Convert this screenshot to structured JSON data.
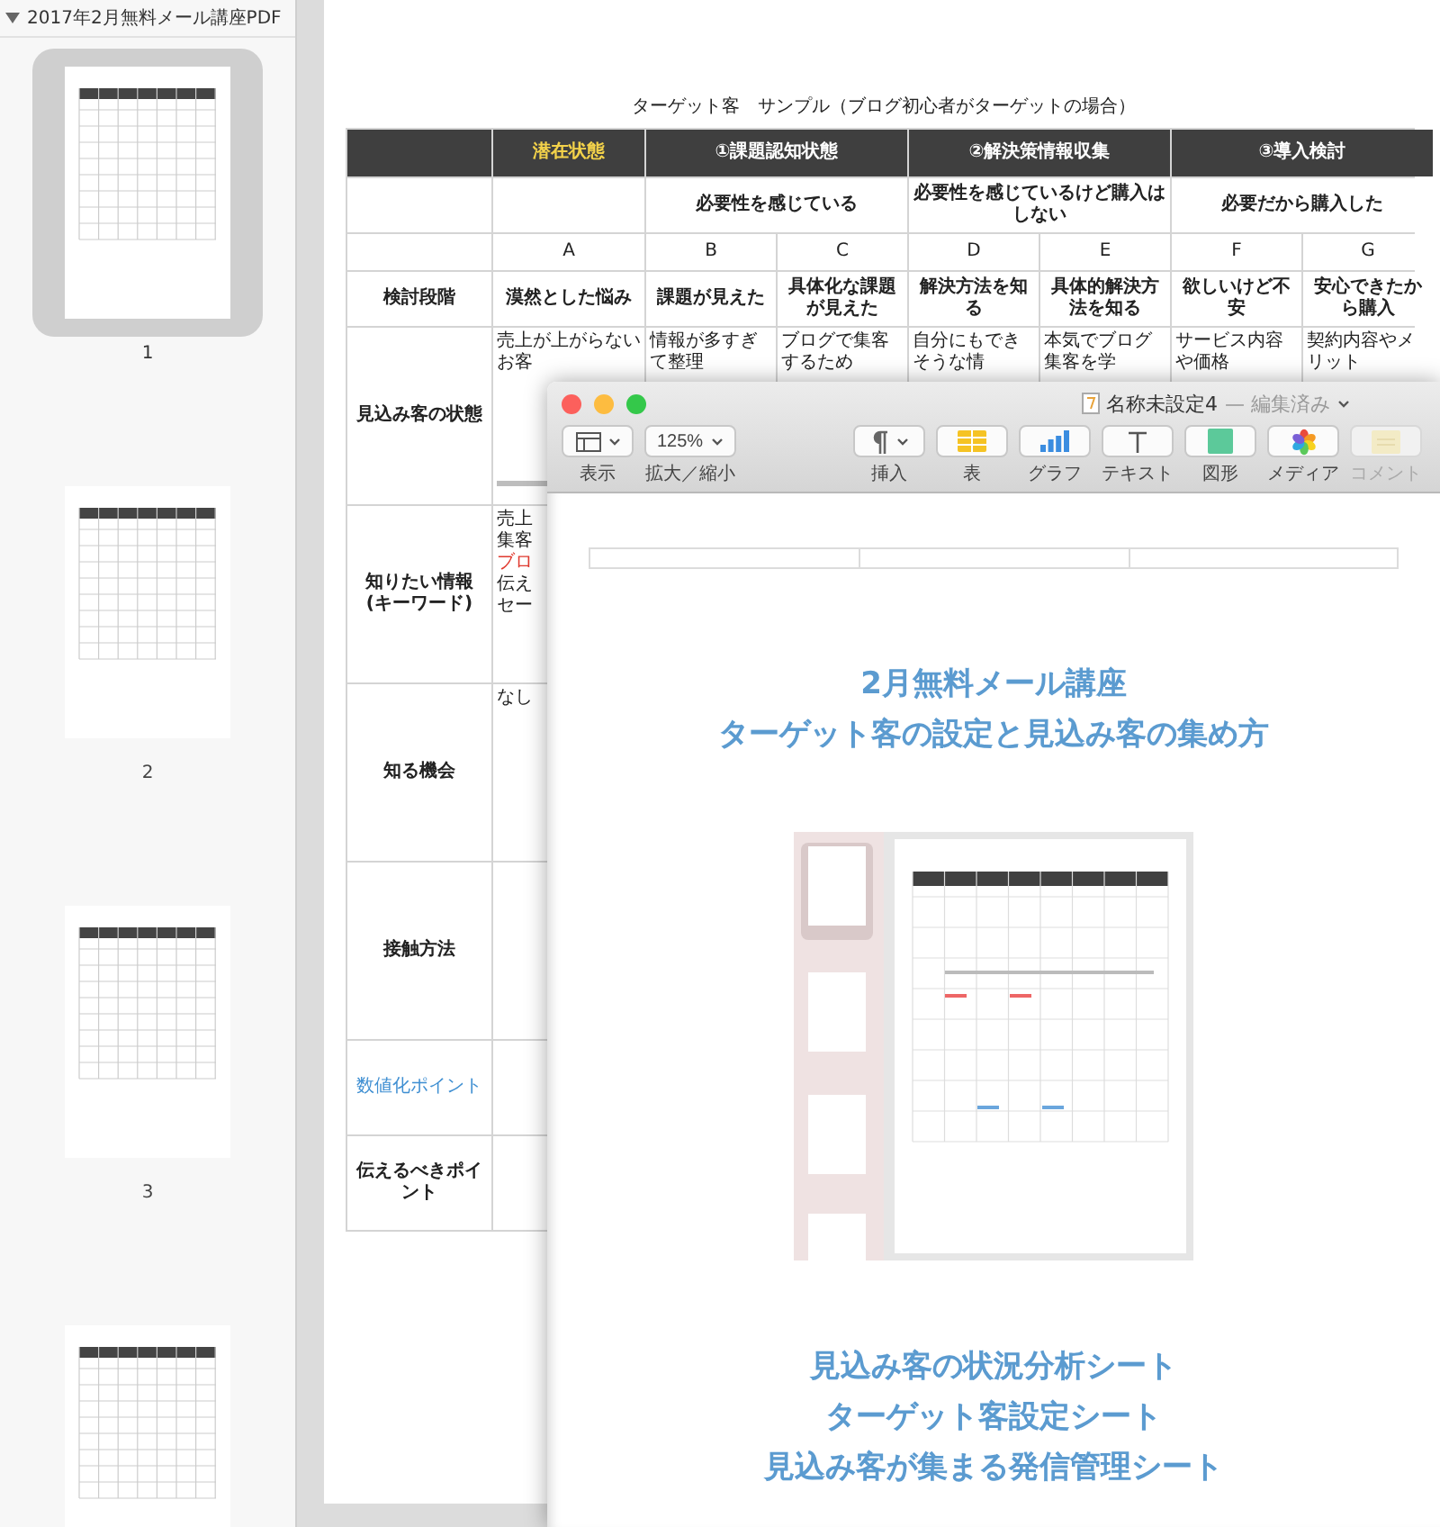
{
  "sidebar": {
    "title": "2017年2月無料メール講座PDF",
    "pages": [
      {
        "label": "1",
        "selected": true
      },
      {
        "label": "2",
        "selected": false
      },
      {
        "label": "3",
        "selected": false
      },
      {
        "selected": false
      }
    ]
  },
  "table": {
    "title": "ターゲット客　サンプル（ブログ初心者がターゲットの場合）",
    "phases": [
      {
        "label": "潜在状態",
        "highlighted": true
      },
      {
        "label": "①課題認知状態",
        "highlighted": false
      },
      {
        "label": "②解決策情報収集",
        "highlighted": false
      },
      {
        "label": "③導入検討",
        "highlighted": false
      }
    ],
    "needs": [
      "必要性を感じている",
      "必要性を感じているけど購入はしない",
      "必要だから購入した"
    ],
    "letters": [
      "A",
      "B",
      "C",
      "D",
      "E",
      "F",
      "G"
    ],
    "stage": {
      "label": "検討段階",
      "cells": [
        "漠然とした悩み",
        "課題が見えた",
        "具体化な課題が見えた",
        "解決方法を知る",
        "具体的解決方法を知る",
        "欲しいけど不安",
        "安心できたから購入"
      ]
    },
    "rows": [
      {
        "label": [
          "見込み客の状態"
        ],
        "highlighted": false,
        "cells": [
          [
            {
              "text": "売上が上がらない",
              "emphasis": false
            },
            {
              "text": "お客",
              "emphasis": false
            }
          ],
          [
            {
              "text": "情報が多すぎて整理",
              "emphasis": false
            }
          ],
          [
            {
              "text": "ブログで集客するため",
              "emphasis": false
            }
          ],
          [
            {
              "text": "自分にもできそうな情",
              "emphasis": false
            }
          ],
          [
            {
              "text": "本気でブログ集客を学",
              "emphasis": false
            }
          ],
          [
            {
              "text": "サービス内容や価格",
              "emphasis": false
            }
          ],
          [
            {
              "text": "契約内容やメリット",
              "emphasis": false
            }
          ]
        ]
      },
      {
        "label": [
          "知りたい情報",
          "(キーワード)"
        ],
        "highlighted": false,
        "cells": [
          [
            {
              "text": "売上",
              "emphasis": false
            },
            {
              "text": "集客",
              "emphasis": false
            },
            {
              "text": "ブロ",
              "emphasis": true
            },
            {
              "text": "伝え",
              "emphasis": false
            },
            {
              "text": "セー",
              "emphasis": false
            }
          ]
        ]
      },
      {
        "label": [
          "知る機会"
        ],
        "highlighted": false,
        "cells": [
          [
            {
              "text": "なし",
              "emphasis": false
            }
          ]
        ]
      },
      {
        "label": [
          "接触方法"
        ],
        "highlighted": false,
        "cells": []
      },
      {
        "label": [
          "数値化ポイント"
        ],
        "highlighted": true,
        "cells": []
      },
      {
        "label": [
          "伝えるべきポイント"
        ],
        "highlighted": false,
        "cells": []
      }
    ]
  },
  "window": {
    "title": "名称未設定4",
    "status": "— 編集済み",
    "toolbar": [
      {
        "kind": "view",
        "label": "表示",
        "disabled": false
      },
      {
        "kind": "zoom",
        "label": "拡大／縮小",
        "value": "125%",
        "disabled": false
      },
      {
        "kind": "insert",
        "label": "挿入",
        "disabled": false
      },
      {
        "kind": "table",
        "label": "表",
        "disabled": false
      },
      {
        "kind": "chart",
        "label": "グラフ",
        "disabled": false
      },
      {
        "kind": "text",
        "label": "テキスト",
        "disabled": false
      },
      {
        "kind": "shape",
        "label": "図形",
        "disabled": false
      },
      {
        "kind": "media",
        "label": "メディア",
        "disabled": false
      },
      {
        "kind": "comment",
        "label": "コメント",
        "disabled": true
      }
    ],
    "document": {
      "heading": [
        "2月無料メール講座",
        "ターゲット客の設定と見込み客の集め方"
      ],
      "sheets": [
        "見込み客の状況分析シート",
        "ターゲット客設定シート",
        "見込み客が集まる発信管理シート"
      ]
    }
  }
}
